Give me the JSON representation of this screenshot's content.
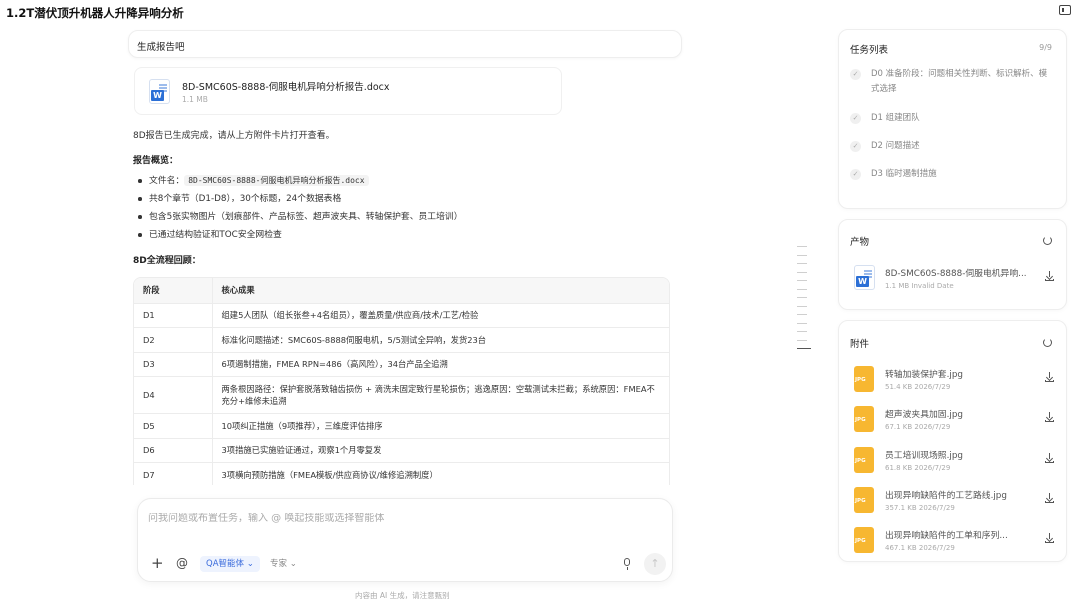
{
  "page_title": "1.2T潜伏顶升机器人升降异响分析",
  "user_message": "生成报告吧",
  "doc_card": {
    "name": "8D-SMC60S-8888-伺服电机异响分析报告.docx",
    "size": "1.1 MB",
    "icon": "W"
  },
  "response": {
    "intro": "8D报告已生成完成，请从上方附件卡片打开查看。",
    "overview_title": "报告概览：",
    "bullets": [
      {
        "label": "文件名：",
        "code": "8D-SMC60S-8888-伺服电机异响分析报告.docx"
      },
      {
        "text": "共8个章节（D1-D8），30个标题，24个数据表格"
      },
      {
        "text": "包含5张实物图片（划痕部件、产品标签、超声波夹具、转轴保护套、员工培训）"
      },
      {
        "text": "已通过结构验证和TOC安全网检查"
      }
    ],
    "review_title": "8D全流程回顾：",
    "table": {
      "headers": [
        "阶段",
        "核心成果"
      ],
      "rows": [
        [
          "D1",
          "组建5人团队（组长张叁+4名组员），覆盖质量/供应商/技术/工艺/检验"
        ],
        [
          "D2",
          "标准化问题描述：SMC60S-8888伺服电机，5/5测试全异响，发货23台"
        ],
        [
          "D3",
          "6项遏制措施，FMEA RPN=486（高风险），34台产品全追溯"
        ],
        [
          "D4",
          "两条根因路径：保护套脱落致轴齿损伤 + 滴洗未固定致行星轮损伤；逃逸原因：空载测试未拦截；系统原因：FMEA不充分+维修未追溯"
        ],
        [
          "D5",
          "10项纠正措施（9项推荐），三维度评估排序"
        ],
        [
          "D6",
          "3项措施已实施验证通过，观察1个月零复发"
        ],
        [
          "D7",
          "3项横向预防措施（FMEA模板/供应商协议/维修追溯制度）"
        ]
      ]
    }
  },
  "input": {
    "placeholder": "问我问题或布置任务，输入 @ 唤起技能或选择智能体",
    "plus": "+",
    "at": "@",
    "agent": "QA智能体 ⌄",
    "expert": "专家 ⌄",
    "send": "↑"
  },
  "disclaimer": "内容由 AI 生成，请注意甄别",
  "task_panel": {
    "title": "任务列表",
    "count": "9/9",
    "check": "✓",
    "tasks": [
      "D0 准备阶段：问题相关性判断、标识解析、模式选择",
      "D1 组建团队",
      "D2 问题描述",
      "D3 临时遏制措施"
    ]
  },
  "product_panel": {
    "title": "产物",
    "item": {
      "name": "8D-SMC60S-8888-伺服电机异响...",
      "meta": "1.1 MB   Invalid Date",
      "icon": "W"
    }
  },
  "attachment_panel": {
    "title": "附件",
    "icon_tag": "JPG",
    "files": [
      {
        "name": "转轴加装保护套.jpg",
        "meta": "51.4 KB   2026/7/29"
      },
      {
        "name": "超声波夹具加固.jpg",
        "meta": "67.1 KB   2026/7/29"
      },
      {
        "name": "员工培训现场照.jpg",
        "meta": "61.8 KB   2026/7/29"
      },
      {
        "name": "出现异响缺陷件的工艺路线.jpg",
        "meta": "357.1 KB   2026/7/29"
      },
      {
        "name": "出现异响缺陷件的工单和序列...",
        "meta": "467.1 KB   2026/7/29"
      }
    ]
  }
}
